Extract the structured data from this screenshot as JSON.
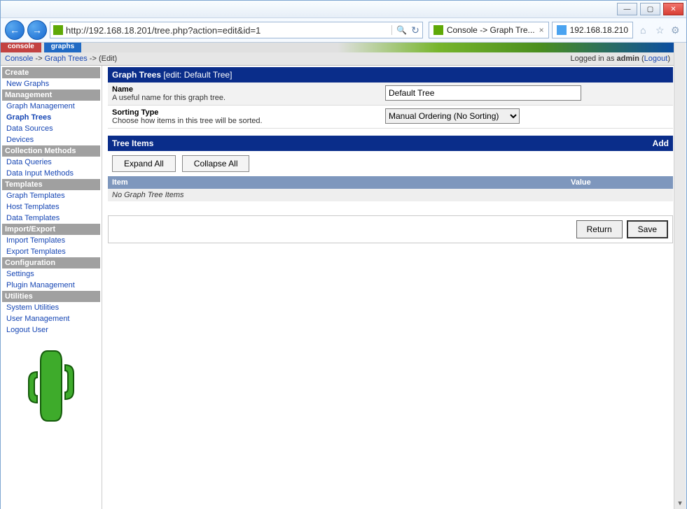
{
  "window": {
    "min": "—",
    "max": "▢",
    "close": "✕"
  },
  "nav": {
    "url": "http://192.168.18.201/tree.php?action=edit&id=1",
    "search_glyph": "🔍",
    "refresh_glyph": "↻",
    "tab1": "Console -> Graph Tre...",
    "tab1_close": "×",
    "tab2": "192.168.18.210",
    "home_glyph": "⌂",
    "star_glyph": "☆",
    "gear_glyph": "⚙"
  },
  "top_tabs": {
    "console": "console",
    "graphs": "graphs"
  },
  "breadcrumb": {
    "console": "Console",
    "sep": "->",
    "graph_trees": "Graph Trees",
    "edit": "(Edit)",
    "logged": "Logged in as ",
    "user": "admin",
    "logout": "Logout"
  },
  "sidebar": {
    "headers": {
      "create": "Create",
      "manage": "Management",
      "collect": "Collection Methods",
      "templates": "Templates",
      "impexp": "Import/Export",
      "config": "Configuration",
      "util": "Utilities"
    },
    "links": {
      "new_graphs": "New Graphs",
      "graph_management": "Graph Management",
      "graph_trees": "Graph Trees",
      "data_sources": "Data Sources",
      "devices": "Devices",
      "data_queries": "Data Queries",
      "data_input": "Data Input Methods",
      "graph_templates": "Graph Templates",
      "host_templates": "Host Templates",
      "data_templates": "Data Templates",
      "import_templates": "Import Templates",
      "export_templates": "Export Templates",
      "settings": "Settings",
      "plugin_management": "Plugin Management",
      "system_utilities": "System Utilities",
      "user_management": "User Management",
      "logout_user": "Logout User"
    }
  },
  "panel": {
    "heading": "Graph Trees ",
    "heading_sub": "[edit: Default Tree]",
    "name_label": "Name",
    "name_desc": "A useful name for this graph tree.",
    "name_value": "Default Tree",
    "sort_label": "Sorting Type",
    "sort_desc": "Choose how items in this tree will be sorted.",
    "sort_value": "Manual Ordering (No Sorting)",
    "tree_heading": "Tree Items",
    "add": "Add",
    "expand": "Expand All",
    "collapse": "Collapse All",
    "col_item": "Item",
    "col_value": "Value",
    "empty": "No Graph Tree Items",
    "return": "Return",
    "save": "Save"
  }
}
